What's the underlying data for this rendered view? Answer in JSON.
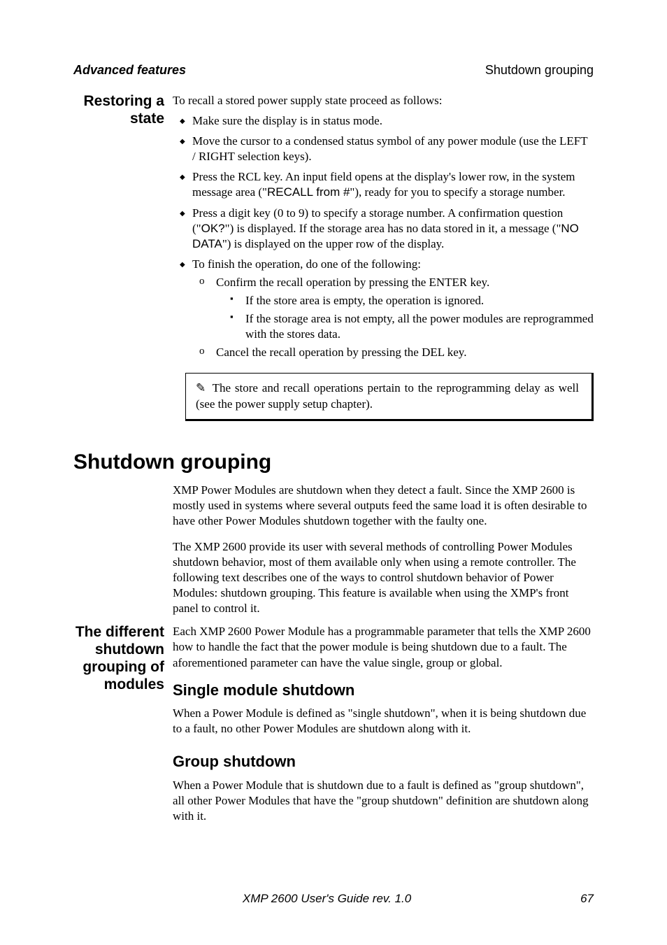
{
  "header": {
    "left": "Advanced features",
    "right": "Shutdown grouping"
  },
  "restoring": {
    "side": "Restoring a state",
    "intro": "To recall a stored power supply state proceed as follows:",
    "b1": "Make sure the display is in status mode.",
    "b2": "Move the cursor to a condensed status symbol of any power module (use the LEFT / RIGHT selection keys).",
    "b3a": "Press the RCL key. An input field opens at the display's lower row, in the system message area (\"",
    "b3b": "RECALL from #",
    "b3c": "\"), ready for you to specify a storage number.",
    "b4a": "Press a digit key (0 to 9) to specify a storage number. A confirmation question (\"",
    "b4b": "OK?",
    "b4c": "\") is displayed. If the storage area has no data stored in it, a message (\"",
    "b4d": "NO DATA",
    "b4e": "\") is displayed on the upper row of the display.",
    "b5": "To finish the operation, do one of the following:",
    "b5a": "Confirm the recall operation by pressing the ENTER key.",
    "b5a1": "If the store area is empty, the operation is ignored.",
    "b5a2": "If the storage area is not empty, all the power modules are reprogrammed with the stores data.",
    "b5b": "Cancel the recall operation by pressing the DEL key.",
    "note_hand": "✎",
    "note": "The store and recall operations pertain to the reprogramming delay as well (see the power supply setup chapter)."
  },
  "shutdown": {
    "title": "Shutdown grouping",
    "p1": "XMP Power Modules are shutdown when they detect a fault. Since the XMP 2600 is mostly used in systems where several outputs feed the same load it is often desirable to have other Power Modules shutdown together with the faulty one.",
    "p2": "The XMP 2600 provide its user with several methods of controlling Power Modules shutdown behavior, most of them available only when using a remote controller. The following text describes one of the ways to control shutdown behavior of Power Modules: shutdown grouping. This feature is available when using the XMP's front panel to control it.",
    "side2": "The different shutdown grouping of modules",
    "p3": "Each XMP 2600 Power Module has a programmable parameter that tells the XMP 2600 how to handle the fact that the power module is being shutdown due to a fault. The aforementioned parameter can have the value single, group or global.",
    "h_single": "Single module shutdown",
    "p_single": "When a Power Module is defined as \"single shutdown\", when it is being shutdown due to a fault, no other Power Modules are shutdown along with it.",
    "h_group": "Group shutdown",
    "p_group": "When a Power Module that is shutdown due to a fault is defined as \"group shutdown\", all other Power Modules that have the \"group shutdown\" definition are shutdown along with it."
  },
  "footer": {
    "center": "XMP 2600 User's Guide rev. 1.0",
    "page": "67"
  }
}
